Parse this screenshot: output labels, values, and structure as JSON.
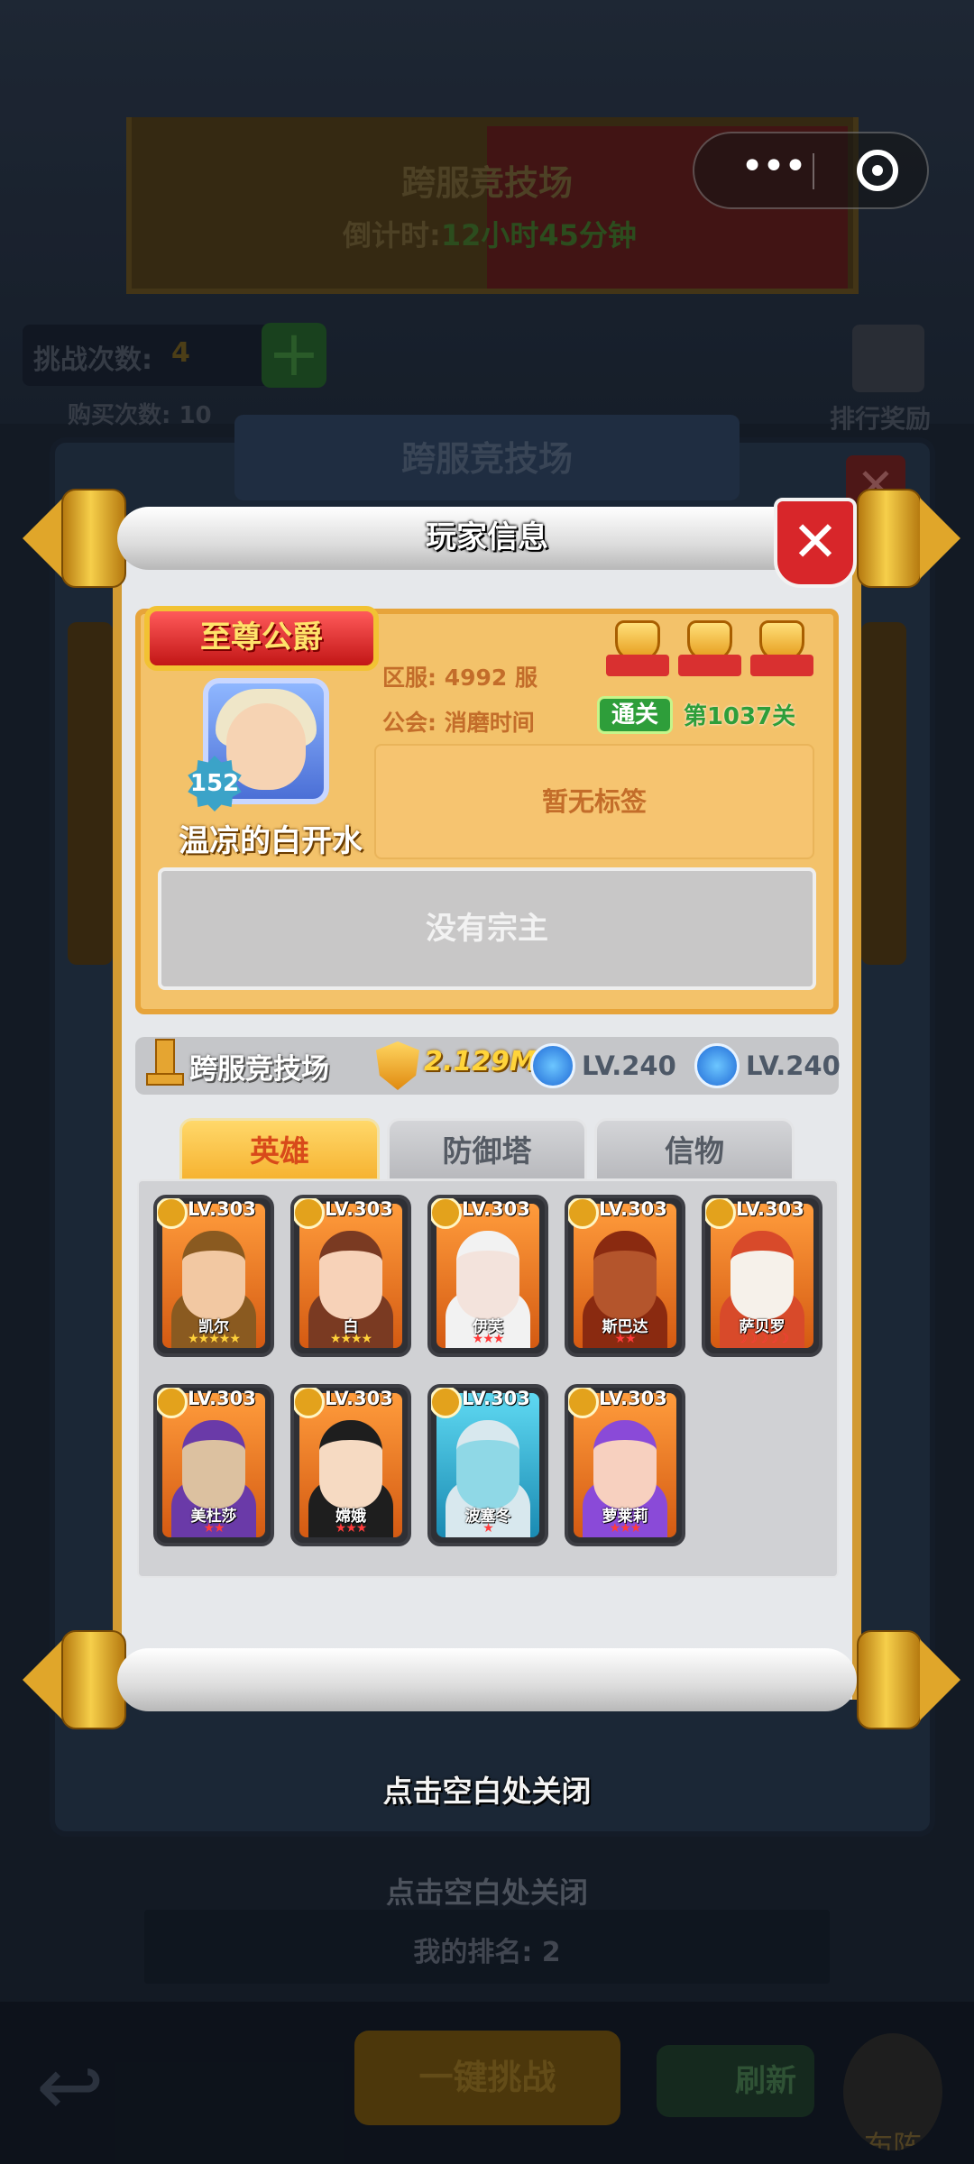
{
  "background": {
    "arena_title": "跨服竞技场",
    "countdown_label": "倒计时:",
    "countdown_value": "12小时45分钟",
    "challenges_label": "挑战次数:",
    "challenges_value": "4",
    "purchase_label": "购买次数:",
    "purchase_value": "10",
    "ranking_reward": "排行奖励",
    "panel_title": "跨服竞技场",
    "close_hint": "点击空白处关闭",
    "my_rank_label": "我的排名:",
    "my_rank_value": "2",
    "one_click_challenge": "一键挑战",
    "refresh": "刷新",
    "formation": "布阵"
  },
  "dialog": {
    "title": "玩家信息",
    "title_badge": "至尊公爵",
    "player_level": "152",
    "player_name": "温凉的白开水",
    "server_label": "区服:",
    "server_value": "4992 服",
    "guild_label": "公会:",
    "guild_value": "消磨时间",
    "pass_badge": "通关",
    "stage": "第1037关",
    "tag_text": "暂无标签",
    "master_text": "没有宗主",
    "arena_label": "跨服竞技场",
    "power": "2.129M",
    "archer_level": "LV.240",
    "tower_level": "LV.240",
    "tabs": [
      "英雄",
      "防御塔",
      "信物"
    ],
    "active_tab": "英雄",
    "heroes": [
      {
        "level": "LV.303",
        "name": "凯尔",
        "stars": "★★★★★",
        "star_color": "#ffd23a"
      },
      {
        "level": "LV.303",
        "name": "白",
        "stars": "★★★★",
        "star_color": "#ffd23a"
      },
      {
        "level": "LV.303",
        "name": "伊芙",
        "stars": "★★★",
        "star_color": "#ff3b3b"
      },
      {
        "level": "LV.303",
        "name": "斯巴达",
        "stars": "★★",
        "star_color": "#ff3b3b"
      },
      {
        "level": "LV.303",
        "name": "萨贝罗",
        "stars": "☽☽☽☽☽",
        "star_color": "#ff3b3b"
      },
      {
        "level": "LV.303",
        "name": "美杜莎",
        "stars": "★★",
        "star_color": "#ff3b3b"
      },
      {
        "level": "LV.303",
        "name": "嫦娥",
        "stars": "★★★",
        "star_color": "#ff3b3b"
      },
      {
        "level": "LV.303",
        "name": "波塞冬",
        "stars": "★",
        "star_color": "#ff3b3b"
      },
      {
        "level": "LV.303",
        "name": "萝莱莉",
        "stars": "★★★",
        "star_color": "#ff3b3b"
      }
    ],
    "close_hint": "点击空白处关闭"
  },
  "colors": {
    "card_gold": "#f3c26a",
    "tab_active": "#f6b331",
    "close_red": "#d8262a",
    "pass_green": "#2e9e3a"
  }
}
